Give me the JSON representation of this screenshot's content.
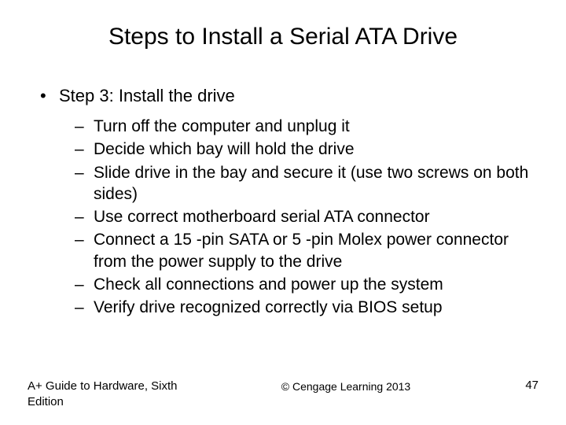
{
  "title": "Steps to Install a Serial ATA Drive",
  "main_bullet": "Step 3: Install the drive",
  "sub_bullets": [
    "Turn off the computer and unplug it",
    "Decide which bay will hold the drive",
    "Slide drive in the bay and secure it (use two screws on both sides)",
    "Use correct motherboard serial ATA connector",
    "Connect a 15 -pin SATA or 5 -pin Molex power connector from the power supply to the drive",
    "Check all connections and power up the system",
    "Verify drive recognized correctly via BIOS setup"
  ],
  "footer": {
    "left": "A+ Guide to Hardware, Sixth Edition",
    "center": "© Cengage Learning  2013",
    "page": "47"
  }
}
